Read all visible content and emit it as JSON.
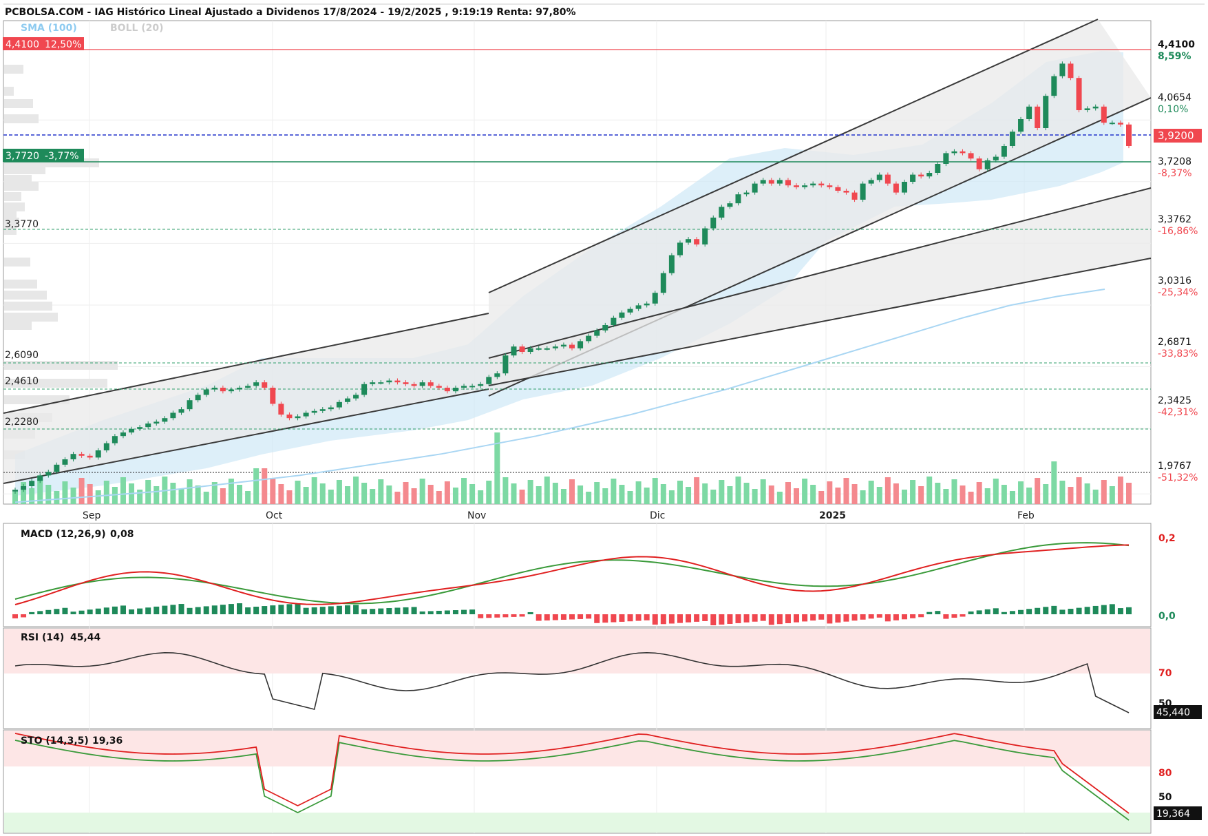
{
  "header": {
    "title": "PCBOLSA.COM - IAG Histórico Lineal Ajustado a Dividenos 17/8/2024 - 19/2/2025 , 9:19:19 Renta: 97,80%",
    "sma_label": "SMA (100)",
    "boll_label": "BOLL (20)"
  },
  "colors": {
    "up": "#1e8a5a",
    "down": "#f0474f",
    "vol_up": "#7dd9a4",
    "vol_down": "#f4898e",
    "sma": "#a9d6f3",
    "boll_fill": "#cfe8f7",
    "channel": "#3a3a3a",
    "channel_fill": "#e9e9e9"
  },
  "levels": {
    "top_left": {
      "price": "4,4100",
      "pct": "12,50%"
    },
    "green_left": {
      "price": "3,7720",
      "pct": "-3,77%"
    },
    "left": [
      "3,3770",
      "2,6090",
      "2,4610",
      "2,2280"
    ],
    "right_top": {
      "price": "4,4100",
      "pct": "8,59%"
    },
    "right_current": "3,9200",
    "right_axis": [
      {
        "price": "4,0654",
        "pct": "0,10%"
      },
      {
        "price": "3,7208",
        "pct": "-8,37%"
      },
      {
        "price": "3,3762",
        "pct": "-16,86%"
      },
      {
        "price": "3,0316",
        "pct": "-25,34%"
      },
      {
        "price": "2,6871",
        "pct": "-33,83%"
      },
      {
        "price": "2,3425",
        "pct": "-42,31%"
      },
      {
        "price": "1,9767",
        "pct": "-51,32%"
      }
    ]
  },
  "months": [
    "Sep",
    "Oct",
    "Nov",
    "Dic",
    "2025",
    "Feb"
  ],
  "macd": {
    "label": "MACD (12,26,9)",
    "value": "0,08",
    "axis": [
      "0,2",
      "0,0"
    ]
  },
  "rsi": {
    "label": "RSI (14)",
    "value": "45,44",
    "axis": [
      "70",
      "50"
    ],
    "current": "45,440"
  },
  "sto": {
    "label": "STO (14,3,5)",
    "value": "19,36",
    "axis": [
      "80",
      "50"
    ],
    "current": "19,364"
  },
  "chart_data": {
    "type": "candlestick",
    "title": "PCBOLSA.COM - IAG Histórico Lineal Ajustado a Dividenos 17/8/2024 - 19/2/2025",
    "ylim": [
      1.92,
      4.62
    ],
    "close": [
      2.0,
      2.02,
      2.05,
      2.08,
      2.1,
      2.14,
      2.17,
      2.2,
      2.19,
      2.18,
      2.22,
      2.26,
      2.3,
      2.32,
      2.34,
      2.35,
      2.37,
      2.38,
      2.4,
      2.43,
      2.45,
      2.5,
      2.53,
      2.56,
      2.57,
      2.55,
      2.56,
      2.57,
      2.58,
      2.6,
      2.57,
      2.48,
      2.42,
      2.4,
      2.41,
      2.43,
      2.44,
      2.45,
      2.46,
      2.49,
      2.51,
      2.53,
      2.59,
      2.6,
      2.6,
      2.61,
      2.6,
      2.59,
      2.58,
      2.6,
      2.58,
      2.57,
      2.55,
      2.57,
      2.58,
      2.58,
      2.59,
      2.63,
      2.65,
      2.75,
      2.8,
      2.77,
      2.79,
      2.79,
      2.79,
      2.8,
      2.81,
      2.79,
      2.83,
      2.86,
      2.89,
      2.92,
      2.96,
      2.99,
      3.01,
      3.03,
      3.04,
      3.1,
      3.21,
      3.31,
      3.38,
      3.4,
      3.37,
      3.46,
      3.52,
      3.58,
      3.6,
      3.65,
      3.66,
      3.71,
      3.73,
      3.71,
      3.73,
      3.7,
      3.69,
      3.7,
      3.71,
      3.7,
      3.69,
      3.67,
      3.66,
      3.62,
      3.71,
      3.73,
      3.76,
      3.71,
      3.66,
      3.72,
      3.76,
      3.75,
      3.77,
      3.82,
      3.88,
      3.89,
      3.88,
      3.85,
      3.79,
      3.84,
      3.86,
      3.92,
      4.0,
      4.07,
      4.14,
      4.02,
      4.2,
      4.31,
      4.38,
      4.3,
      4.12,
      4.13,
      4.14,
      4.05,
      4.05,
      4.04,
      3.92
    ],
    "note": "",
    "sma100": [
      1.93,
      1.95,
      1.97,
      1.99,
      2.02,
      2.05,
      2.08,
      2.12,
      2.16,
      2.2,
      2.25,
      2.3,
      2.36,
      2.42,
      2.49,
      2.56,
      2.64,
      2.72,
      2.8,
      2.88,
      2.96,
      3.03,
      3.08,
      3.12
    ],
    "volume_spike_date": "Nov",
    "months": [
      "Sep",
      "Oct",
      "Nov",
      "Dic",
      "2025",
      "Feb"
    ]
  }
}
